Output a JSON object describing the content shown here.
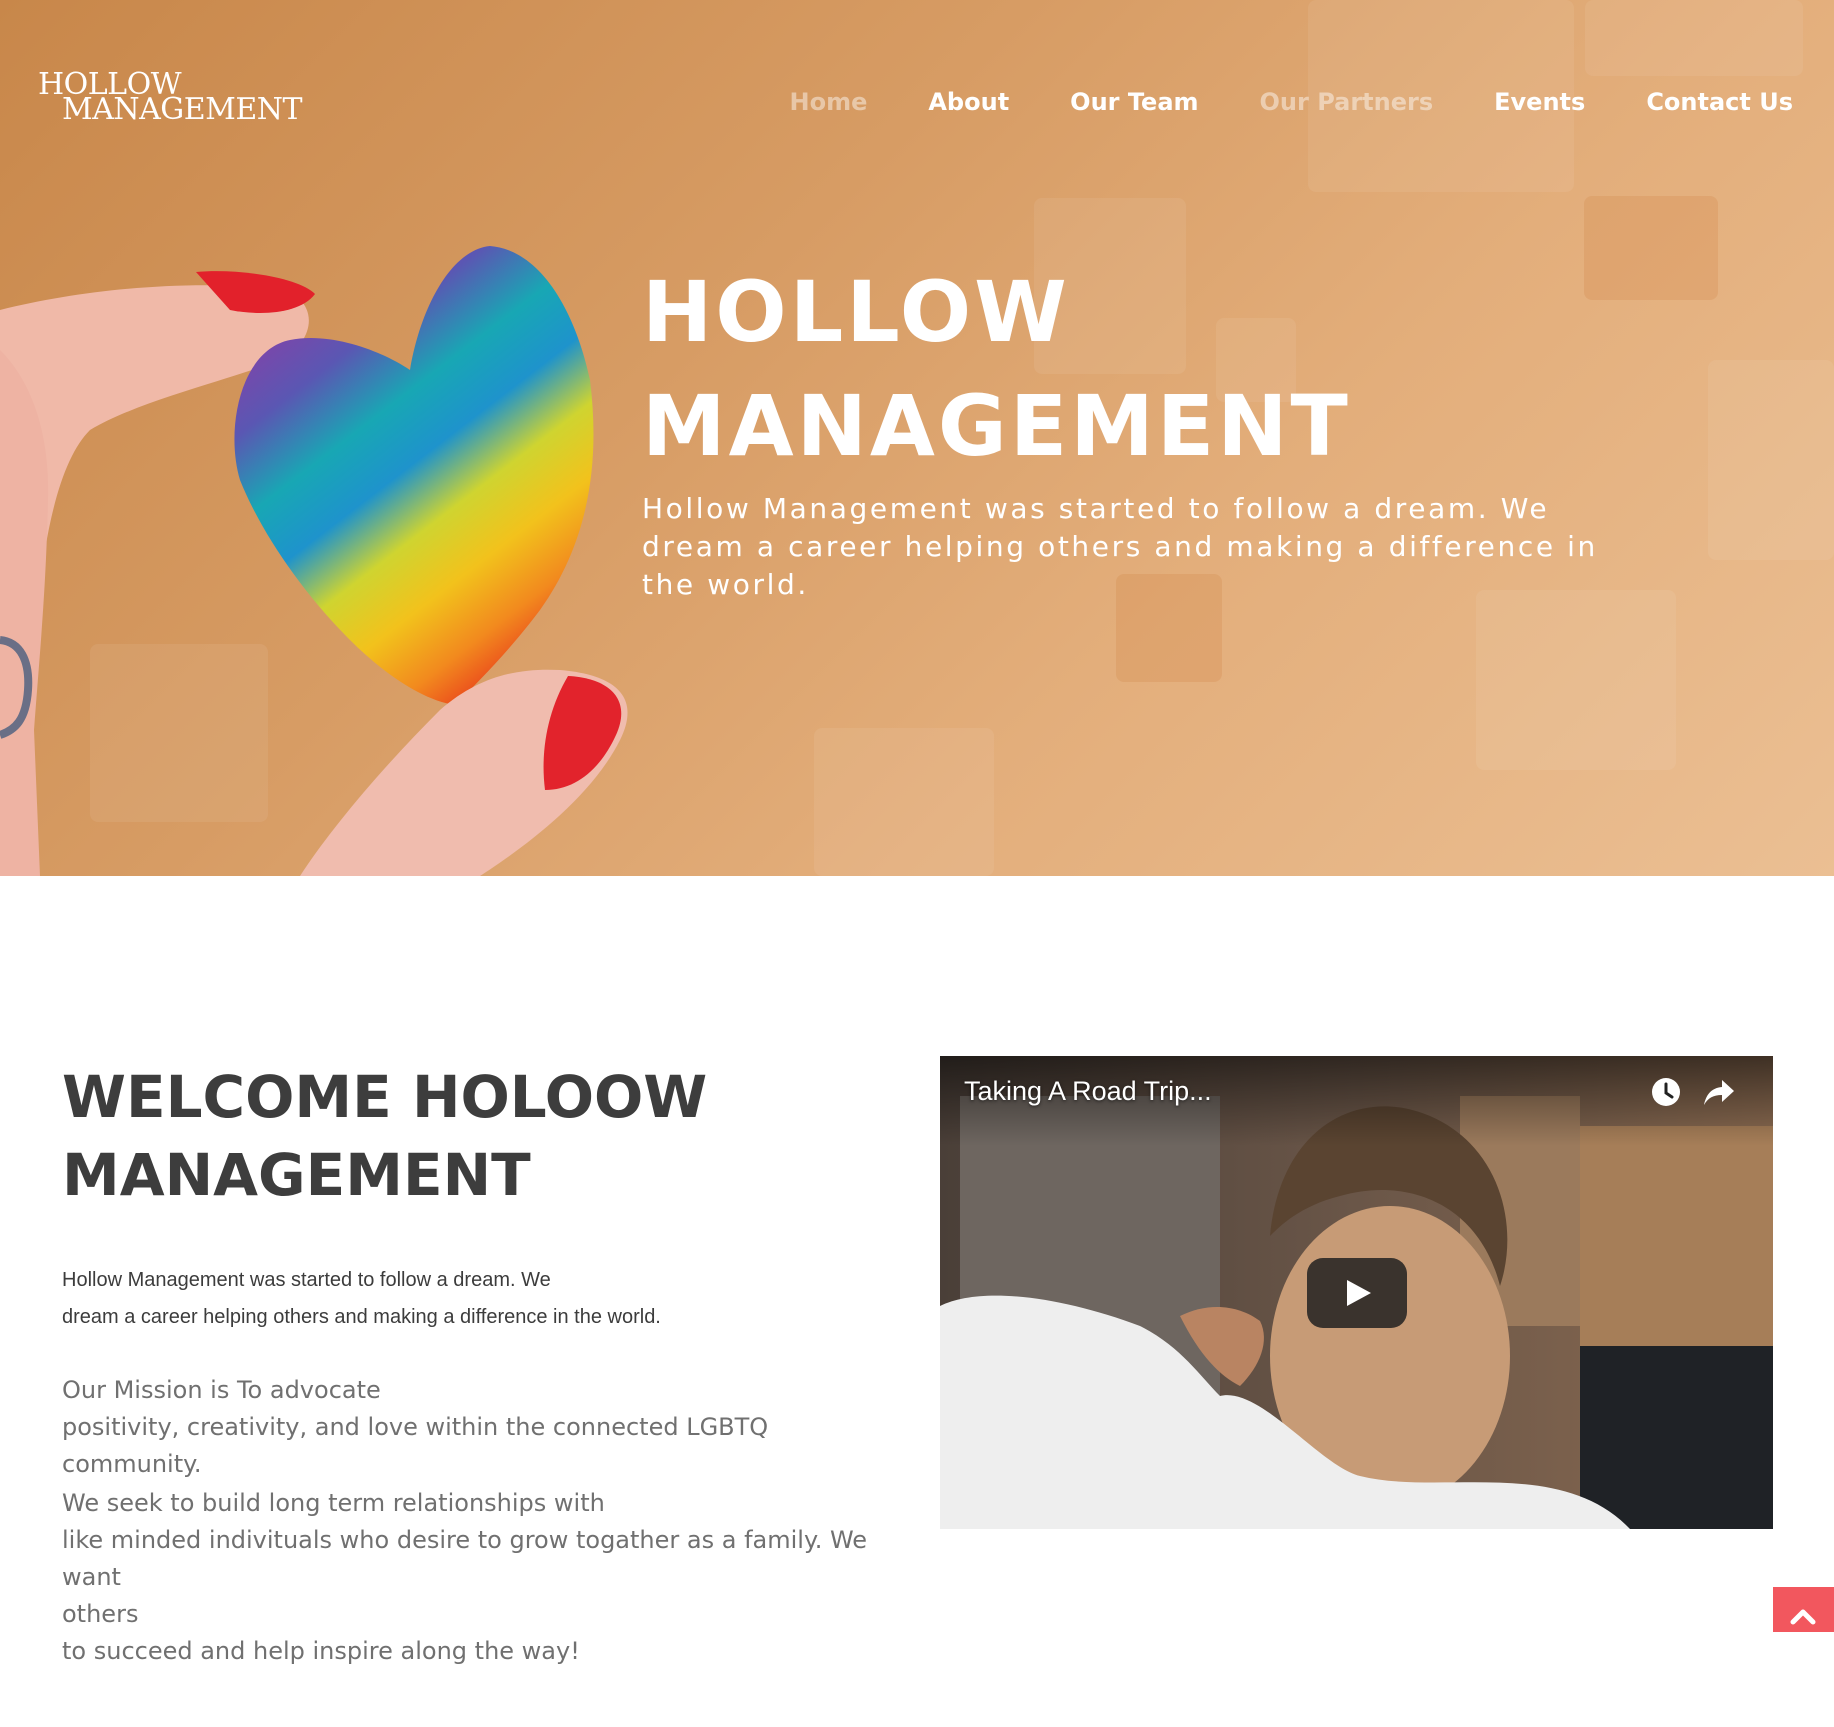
{
  "brand": {
    "logo_line1": "HOLLOW",
    "logo_line2": "MANAGEMENT"
  },
  "nav": [
    {
      "label": "Home"
    },
    {
      "label": "About"
    },
    {
      "label": "Our Team"
    },
    {
      "label": "Our Partners"
    },
    {
      "label": "Events"
    },
    {
      "label": "Contact Us"
    }
  ],
  "hero": {
    "title_line1": "HOLLOW",
    "title_line2": "MANAGEMENT",
    "subtitle": "Hollow Management was started to follow a dream. We dream a career helping others and making a difference in the world."
  },
  "welcome": {
    "title_line1": "WELCOME HOLOOW",
    "title_line2": "MANAGEMENT",
    "intro_line1": "Hollow Management was started to follow a dream. We",
    "intro_line2": "dream a career helping others and making a difference in the world.",
    "mission_line1": "Our Mission is To advocate",
    "mission_line2": "positivity, creativity, and love within the connected LGBTQ community.",
    "seek_line1": "We seek to build long term relationships with",
    "seek_line2": "like minded indivituals who desire to grow togather as a family. We want",
    "seek_line3": "others",
    "seek_line4": "to succeed and help inspire along the way!"
  },
  "video": {
    "title": "Taking A Road Trip...",
    "icons": [
      "watch-later-icon",
      "share-icon",
      "play-icon"
    ]
  },
  "colors": {
    "hero_start": "#c8874a",
    "hero_end": "#ebbf93",
    "heading_text": "#3d3d3d",
    "body_text": "#707070",
    "back_to_top": "#f2575e"
  },
  "back_to_top": {
    "icon": "chevron-up-icon"
  }
}
